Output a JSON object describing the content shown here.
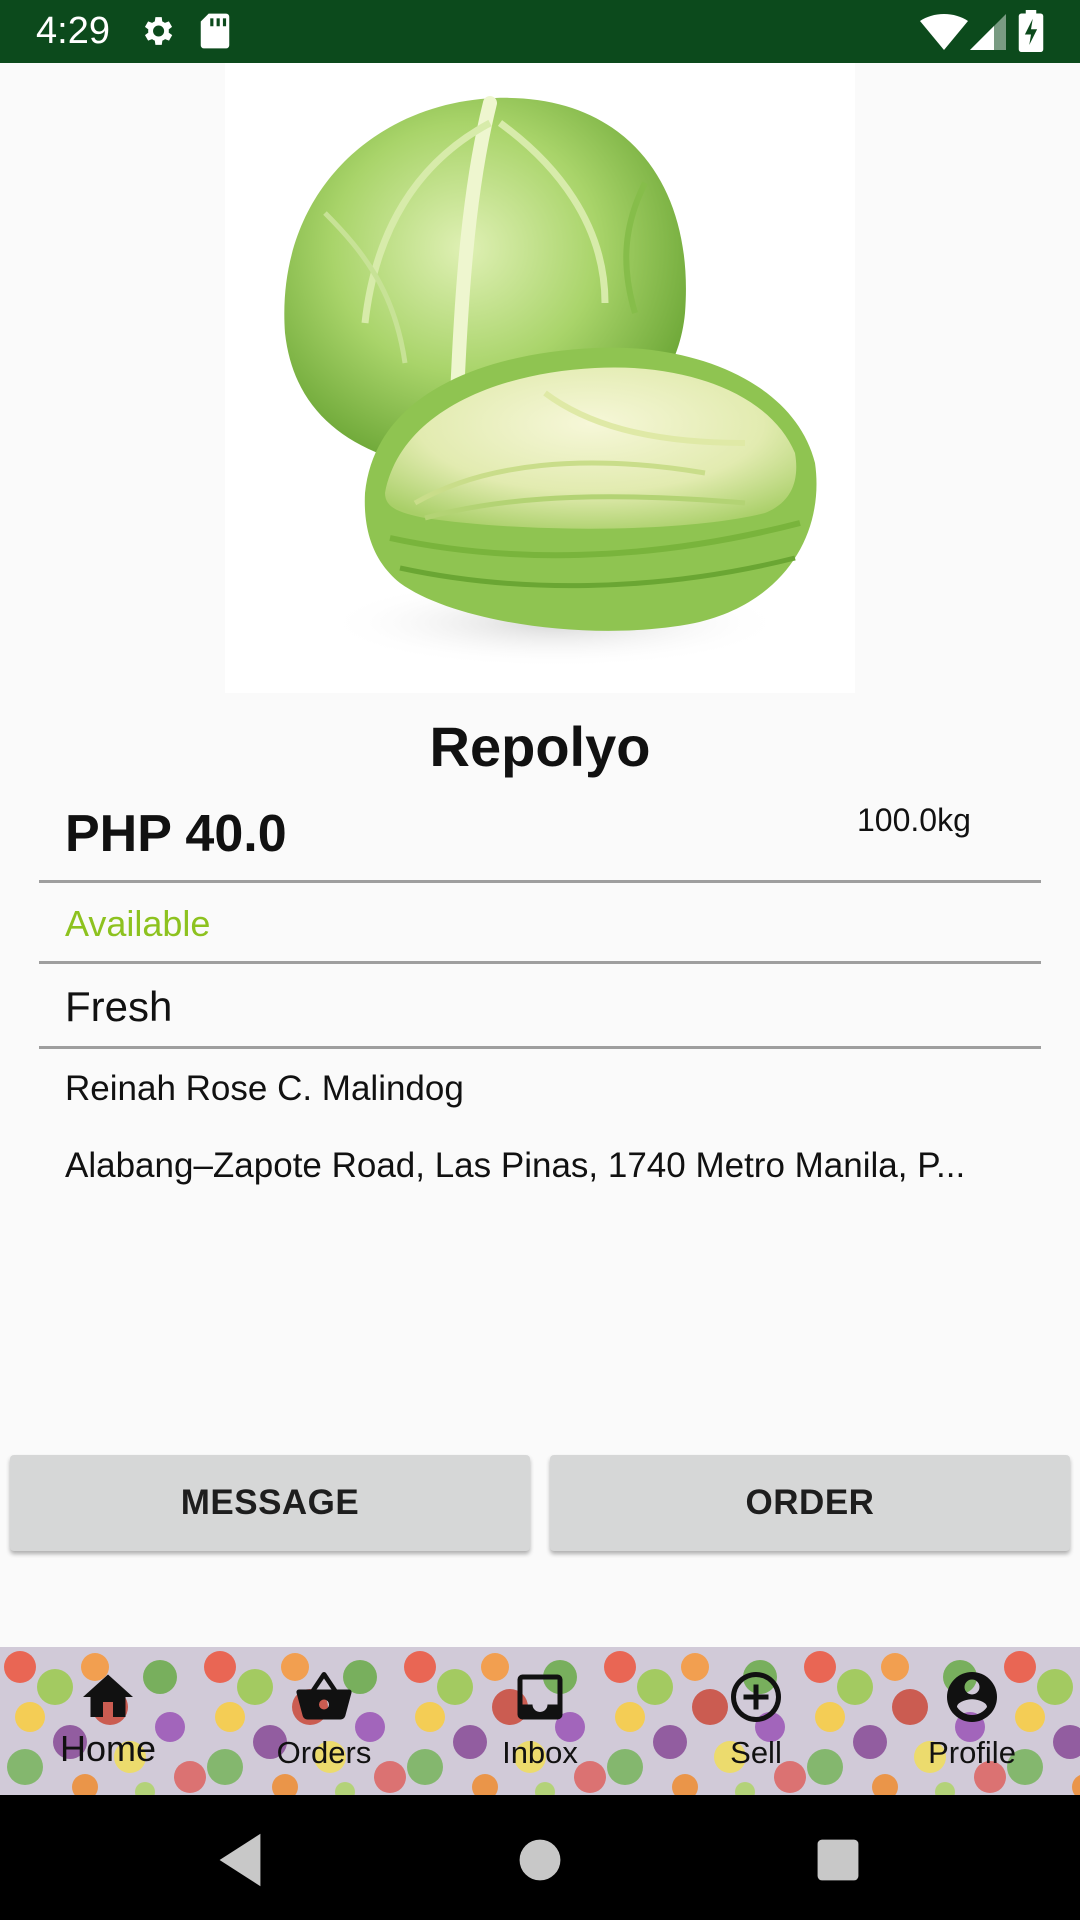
{
  "status_bar": {
    "time": "4:29",
    "icons": [
      "gear-icon",
      "sd-card-icon",
      "wifi-icon",
      "signal-icon",
      "battery-charging-icon"
    ],
    "background": "#0c4a1c"
  },
  "product": {
    "image": "cabbage-image",
    "title": "Repolyo",
    "price": "PHP 40.0",
    "weight": "100.0kg",
    "availability": "Available",
    "availability_color": "#8dc21f",
    "condition": "Fresh",
    "seller_name": "Reinah Rose C. Malindog",
    "seller_address": "Alabang–Zapote Road, Las Pinas, 1740 Metro Manila, P..."
  },
  "actions": {
    "message_label": "MESSAGE",
    "order_label": "ORDER"
  },
  "bottom_nav": {
    "items": [
      {
        "label": "Home",
        "icon": "home-icon",
        "active": true
      },
      {
        "label": "Orders",
        "icon": "basket-icon",
        "active": false
      },
      {
        "label": "Inbox",
        "icon": "inbox-icon",
        "active": false
      },
      {
        "label": "Sell",
        "icon": "add-circle-icon",
        "active": false
      },
      {
        "label": "Profile",
        "icon": "account-circle-icon",
        "active": false
      }
    ]
  },
  "system_nav": [
    "back-icon",
    "home-circle-icon",
    "recents-icon"
  ]
}
